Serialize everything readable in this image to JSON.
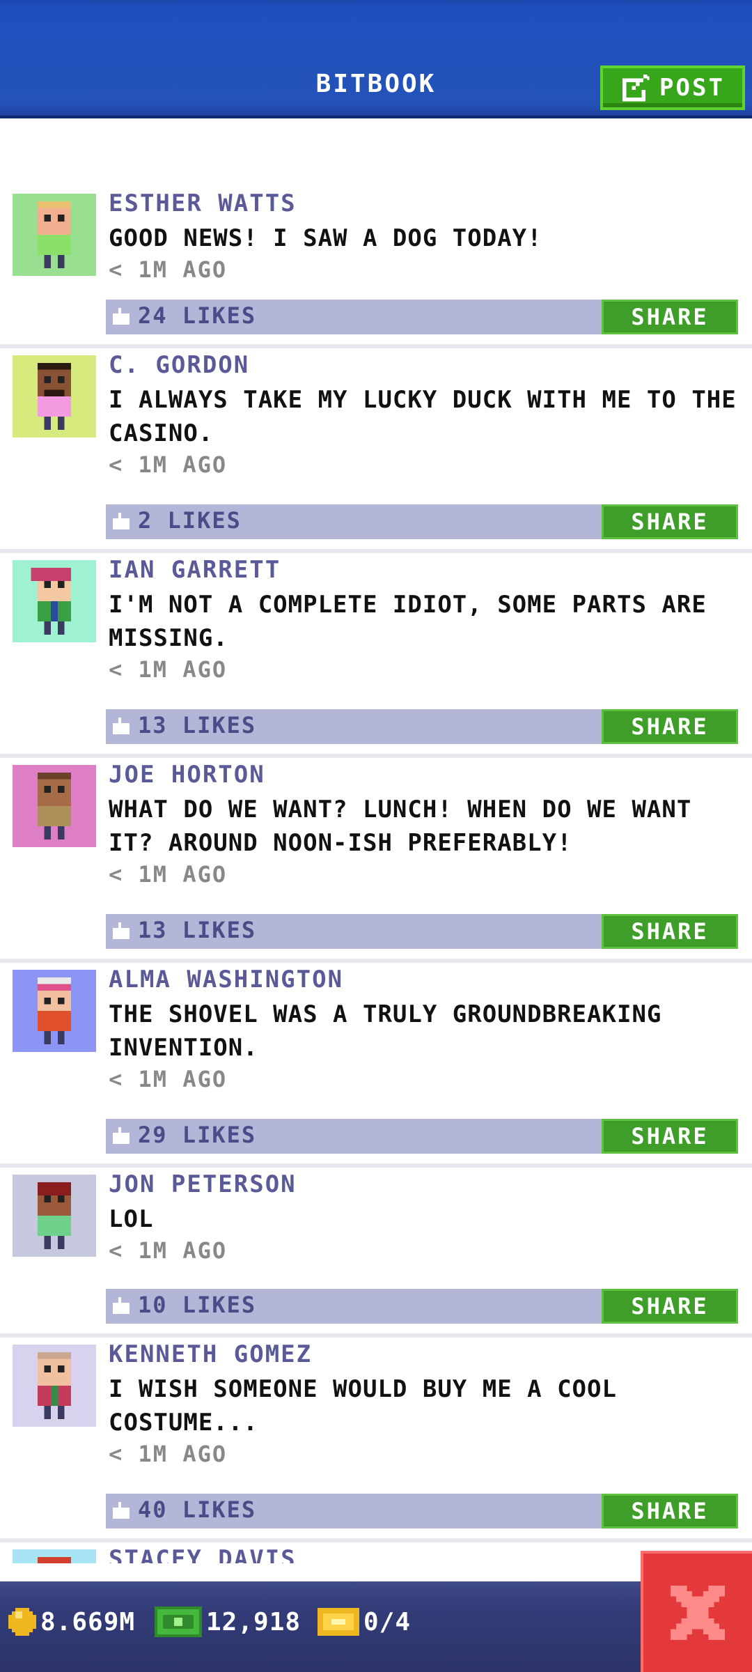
{
  "header": {
    "title": "BITBOOK",
    "post_label": "POST"
  },
  "posts": [
    {
      "name": "ESTHER WATTS",
      "text": "GOOD NEWS! I SAW A DOG TODAY!",
      "time": "< 1M AGO",
      "likes": "24 LIKES",
      "share": "SHARE",
      "avatar_bg": "#98e08f",
      "skin": "#f0b090",
      "shirt": "#8be06a",
      "hair": "#e8c070"
    },
    {
      "name": "C. GORDON",
      "text": "I ALWAYS TAKE MY LUCKY DUCK WITH ME TO THE CASINO.",
      "time": "< 1M AGO",
      "likes": "2 LIKES",
      "share": "SHARE",
      "avatar_bg": "#d6ea7e",
      "skin": "#8a5234",
      "shirt": "#f39ae0",
      "hair": "#2a1a10"
    },
    {
      "name": "IAN GARRETT",
      "text": "I'M NOT A COMPLETE IDIOT, SOME PARTS ARE MISSING.",
      "time": "< 1M AGO",
      "likes": "13 LIKES",
      "share": "SHARE",
      "avatar_bg": "#9ef2d2",
      "skin": "#f4c8a0",
      "shirt": "#3aa046",
      "hair": "#c83e6e"
    },
    {
      "name": "JOE HORTON",
      "text": "WHAT DO WE WANT? LUNCH! WHEN DO WE WANT IT? AROUND NOON-ISH PREFERABLY!",
      "time": "< 1M AGO",
      "likes": "13 LIKES",
      "share": "SHARE",
      "avatar_bg": "#de7ec4",
      "skin": "#a66c48",
      "shirt": "#b0905a",
      "hair": "#6a4028"
    },
    {
      "name": "ALMA WASHINGTON",
      "text": "THE SHOVEL WAS A TRULY GROUNDBREAKING INVENTION.",
      "time": "< 1M AGO",
      "likes": "29 LIKES",
      "share": "SHARE",
      "avatar_bg": "#8c94f4",
      "skin": "#f2c0a0",
      "shirt": "#e0502a",
      "hair": "#eaeaea"
    },
    {
      "name": "JON PETERSON",
      "text": "LOL",
      "time": "< 1M AGO",
      "likes": "10 LIKES",
      "share": "SHARE",
      "avatar_bg": "#c6c8de",
      "skin": "#9a5a3a",
      "shirt": "#6ed08a",
      "hair": "#8a1e1e"
    },
    {
      "name": "KENNETH GOMEZ",
      "text": "I WISH SOMEONE WOULD BUY ME A COOL COSTUME...",
      "time": "< 1M AGO",
      "likes": "40 LIKES",
      "share": "SHARE",
      "avatar_bg": "#d8d2ee",
      "skin": "#f0c0a0",
      "shirt": "#c43c5c",
      "hair": "#caa890"
    },
    {
      "name": "STACEY DAVIS",
      "avatar_bg": "#a8e4f4",
      "skin": "#f0c0a0",
      "shirt": "#c03030",
      "hair": "#d0402a"
    }
  ],
  "status": {
    "coins": "8.669M",
    "bux": "12,918",
    "tickets": "0/4"
  },
  "colors": {
    "accent": "#1e4fbf",
    "post_button": "#37a61a",
    "share_button": "#3f9e2a",
    "close_button": "#e3393b",
    "like_bar": "#b4b6d8"
  },
  "icons": {
    "post": "edit-icon",
    "like": "thumbs-up-icon",
    "coin": "coin-icon",
    "bux": "cash-icon",
    "ticket": "ticket-icon",
    "close": "close-icon"
  }
}
